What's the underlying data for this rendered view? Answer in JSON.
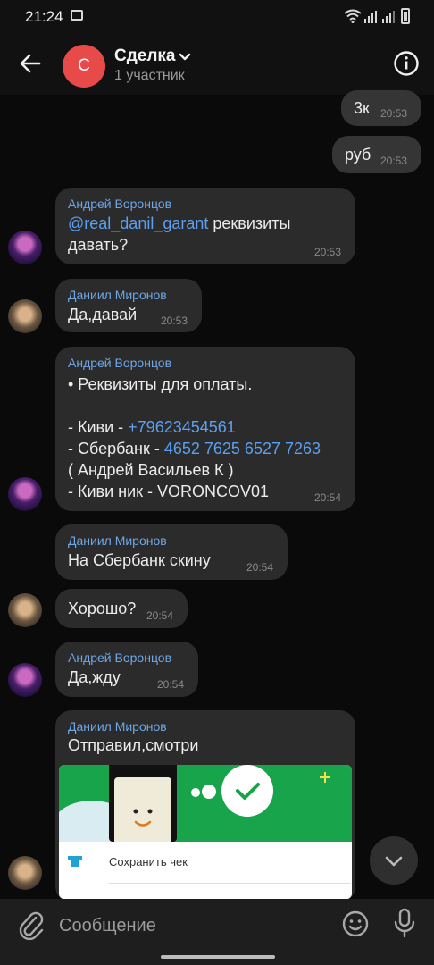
{
  "status_bar": {
    "time": "21:24"
  },
  "header": {
    "avatar_letter": "С",
    "title": "Сделка",
    "subtitle": "1 участник",
    "accent": "#e84a4a"
  },
  "messages": [
    {
      "id": "m1",
      "direction": "out",
      "text": "3к",
      "time": "20:53"
    },
    {
      "id": "m2",
      "direction": "out",
      "text": "руб",
      "time": "20:53"
    },
    {
      "id": "m3",
      "direction": "in",
      "sender": "Андрей Воронцов",
      "mention": "@real_danil_garant",
      "text_after_mention": " реквизиты",
      "text_line2": "давать?",
      "time": "20:53"
    },
    {
      "id": "m4",
      "direction": "in",
      "sender": "Даниил Миронов",
      "text": "Да,давай",
      "time": "20:53"
    },
    {
      "id": "m5",
      "direction": "in",
      "sender": "Андрей Воронцов",
      "line1": "• Реквизиты для оплаты.",
      "qiwi_label": "- Киви - ",
      "qiwi_value": "+79623454561",
      "sber_label": "- Сбербанк - ",
      "sber_value": "4652 7625 6527 7263",
      "name_line": "( Андрей Васильев К )",
      "nick_line": "- Киви ник - VORONCOV01",
      "time": "20:54"
    },
    {
      "id": "m6",
      "direction": "in",
      "sender": "Даниил Миронов",
      "text": "На Сбербанк скину",
      "time": "20:54"
    },
    {
      "id": "m7",
      "direction": "in",
      "text": "Хорошо?",
      "time": "20:54"
    },
    {
      "id": "m8",
      "direction": "in",
      "sender": "Андрей Воронцов",
      "text": "Да,жду",
      "time": "20:54"
    },
    {
      "id": "m9",
      "direction": "in",
      "sender": "Даниил Миронов",
      "text": "Отправил,смотри",
      "attachment_text": "Сохранить чек"
    }
  ],
  "composer": {
    "placeholder": "Сообщение"
  },
  "colors": {
    "link": "#5d9ff0",
    "sender_name": "#6fa6e6",
    "bubble": "#2b2b2b"
  },
  "icons": [
    "back-arrow-icon",
    "chevron-down-icon",
    "info-icon",
    "paperclip-icon",
    "emoji-icon",
    "microphone-icon",
    "scroll-down-icon",
    "check-icon"
  ]
}
